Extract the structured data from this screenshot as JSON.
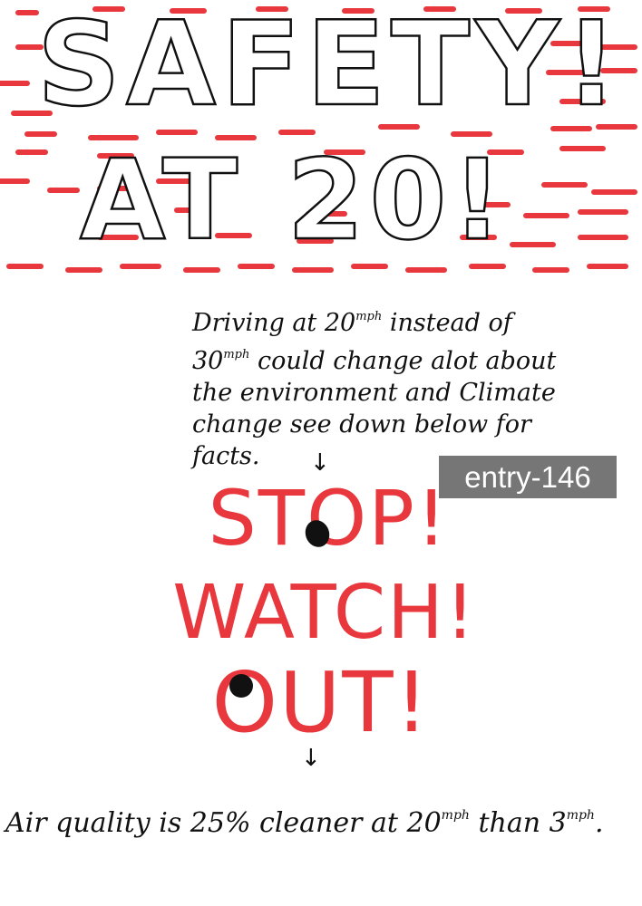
{
  "title": {
    "line1": "SAFETY!",
    "line2": "AT 20!"
  },
  "paragraph": {
    "p1": "Driving at 20",
    "unit1": "mph",
    "p2": " instead of 30",
    "unit2": "mph",
    "p3": " could change alot about the environment and Climate change see down below for facts."
  },
  "tag": "entry-146",
  "warnings": {
    "stop": "STOP!",
    "watch": "WATCH!",
    "out": "OUT!"
  },
  "arrow": "↓",
  "fact": {
    "t1": "Air quality is 25% cleaner at 20",
    "unit1": "mph",
    "t2": " than 3",
    "unit2": "mph",
    "t3": "."
  },
  "colors": {
    "accent": "#e8383d",
    "ink": "#111111",
    "tag_bg": "#767676"
  }
}
